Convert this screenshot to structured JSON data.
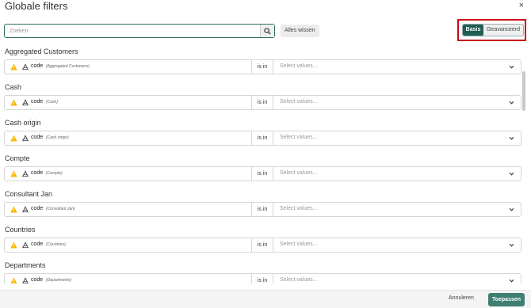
{
  "dialog": {
    "title": "Globale filters",
    "close_label": "×"
  },
  "toolbar": {
    "search_placeholder": "Zoeken",
    "clear_label": "Alles wissen",
    "search_icon": "search-icon"
  },
  "mode": {
    "basis_label": "Basis",
    "advanced_label": "Geavanceerd",
    "selected": "Basis"
  },
  "filters": [
    {
      "label": "Aggregated Customers",
      "field": "code",
      "source": "(Aggregated Customers)",
      "operator": "is in",
      "placeholder": "Select values..."
    },
    {
      "label": "Cash",
      "field": "code",
      "source": "(Cash)",
      "operator": "is in",
      "placeholder": "Select values..."
    },
    {
      "label": "Cash origin",
      "field": "code",
      "source": "(Cash origin)",
      "operator": "is in",
      "placeholder": "Select values..."
    },
    {
      "label": "Compte",
      "field": "code",
      "source": "(Compte)",
      "operator": "is in",
      "placeholder": "Select values..."
    },
    {
      "label": "Consultant Jan",
      "field": "code",
      "source": "(Consultant Jan)",
      "operator": "is in",
      "placeholder": "Select values..."
    },
    {
      "label": "Countries",
      "field": "code",
      "source": "(Countries)",
      "operator": "is in",
      "placeholder": "Select values..."
    },
    {
      "label": "Departments",
      "field": "code",
      "source": "(Departments)",
      "operator": "is in",
      "placeholder": "Select values..."
    }
  ],
  "footer": {
    "cancel_label": "Annuleren",
    "apply_label": "Toepassen"
  },
  "colors": {
    "accent": "#1f5e52",
    "apply": "#3f7f72",
    "warning": "#f5b301",
    "highlight_frame": "#d0021b"
  }
}
